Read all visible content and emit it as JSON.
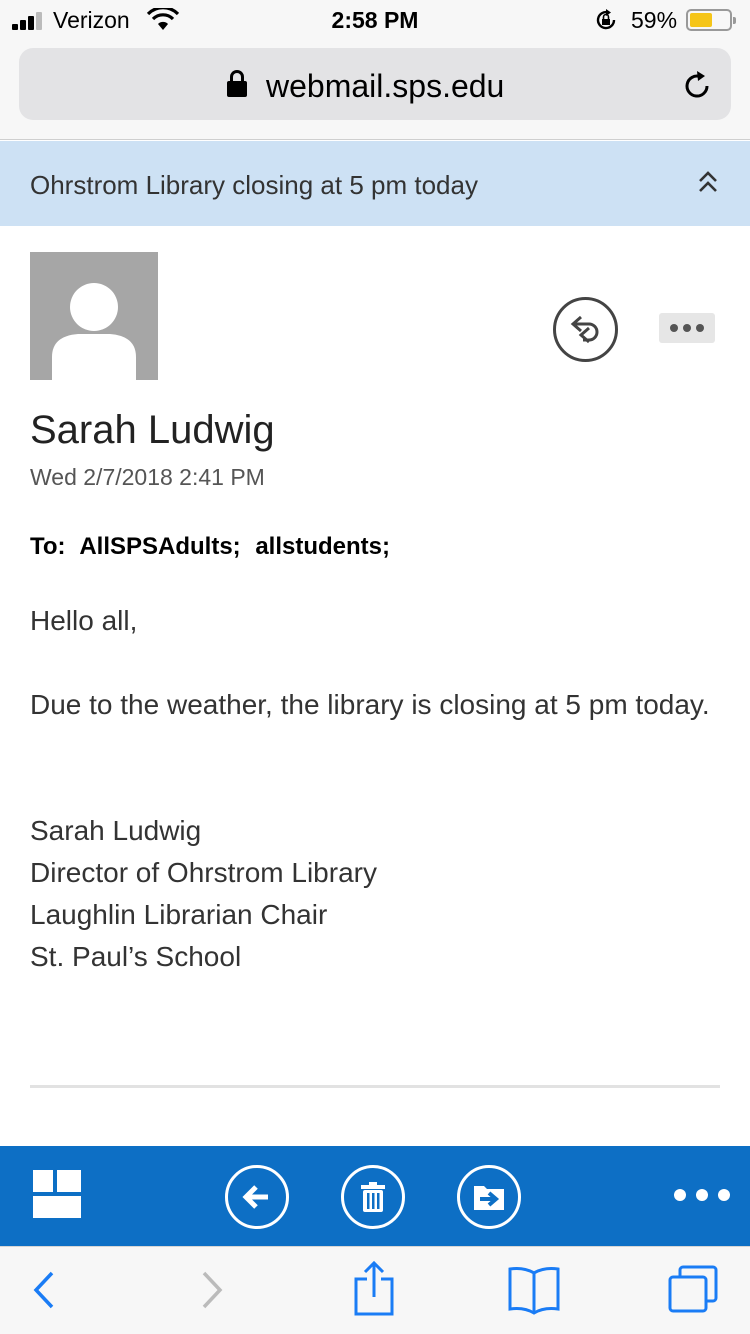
{
  "status_bar": {
    "carrier": "Verizon",
    "time": "2:58 PM",
    "battery_percent": "59%",
    "battery_level": 0.59,
    "battery_color": "#f5c518",
    "icons": [
      "signal-icon",
      "wifi-icon",
      "rotation-lock-icon",
      "battery-icon"
    ]
  },
  "browser": {
    "url": "webmail.sps.edu",
    "icons": [
      "lock-icon",
      "reload-icon"
    ]
  },
  "message": {
    "subject": "Ohrstrom Library closing at 5 pm today",
    "sender": "Sarah Ludwig",
    "date": "Wed 2/7/2018 2:41 PM",
    "to_label": "To:",
    "recipients": [
      "AllSPSAdults;",
      "allstudents;"
    ],
    "greeting": "Hello all,",
    "body": "Due to the weather, the library is closing at 5 pm today.",
    "signature": [
      "Sarah Ludwig",
      "Director of Ohrstrom Library",
      "Laughlin Librarian Chair",
      "St. Paul’s School"
    ]
  },
  "toolbar": {
    "color": "#0d6fc5",
    "icons": [
      "apps-icon",
      "back-arrow-icon",
      "trash-icon",
      "move-to-folder-icon",
      "more-icon"
    ]
  },
  "safari_toolbar": {
    "icons": [
      "back-icon",
      "forward-icon",
      "share-icon",
      "bookmarks-icon",
      "tabs-icon"
    ]
  },
  "colors": {
    "subject_banner": "#cde1f4",
    "safari_blue": "#1a7cf5"
  }
}
